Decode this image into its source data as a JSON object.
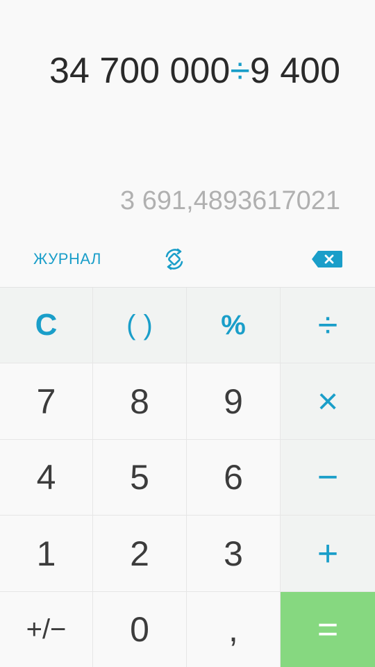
{
  "display": {
    "expression_left": "34 700 000",
    "expression_op": "÷",
    "expression_right": "9 400",
    "result": "3 691,4893617021"
  },
  "toolbar": {
    "history_label": "ЖУРНАЛ",
    "rotate_icon": "rotate-screen-icon",
    "backspace_icon": "backspace-icon"
  },
  "keys": {
    "clear": "C",
    "parentheses": "( )",
    "percent": "%",
    "divide": "÷",
    "seven": "7",
    "eight": "8",
    "nine": "9",
    "multiply": "×",
    "four": "4",
    "five": "5",
    "six": "6",
    "minus": "−",
    "one": "1",
    "two": "2",
    "three": "3",
    "plus": "+",
    "sign": "+/−",
    "zero": "0",
    "decimal": ",",
    "equals": "="
  },
  "colors": {
    "accent": "#1a9ec9",
    "equals_bg": "#86d880",
    "function_key_bg": "#f1f3f2",
    "background": "#f9f9f9"
  }
}
